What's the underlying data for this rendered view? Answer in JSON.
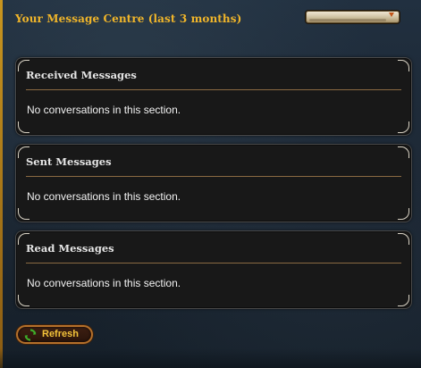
{
  "header": {
    "title": "Your Message Centre (last 3 months)"
  },
  "filter_dropdown": {
    "selected": "",
    "icon": "chevron-down-icon"
  },
  "sections": [
    {
      "title": "Received Messages",
      "empty_text": "No conversations in this section."
    },
    {
      "title": "Sent Messages",
      "empty_text": "No conversations in this section."
    },
    {
      "title": "Read Messages",
      "empty_text": "No conversations in this section."
    }
  ],
  "refresh": {
    "label": "Refresh",
    "icon": "refresh-icon"
  },
  "colors": {
    "accent_gold": "#f0b52a",
    "panel_bg": "#181818",
    "rule": "#8a6a42",
    "refresh_green": "#3fae2a"
  }
}
